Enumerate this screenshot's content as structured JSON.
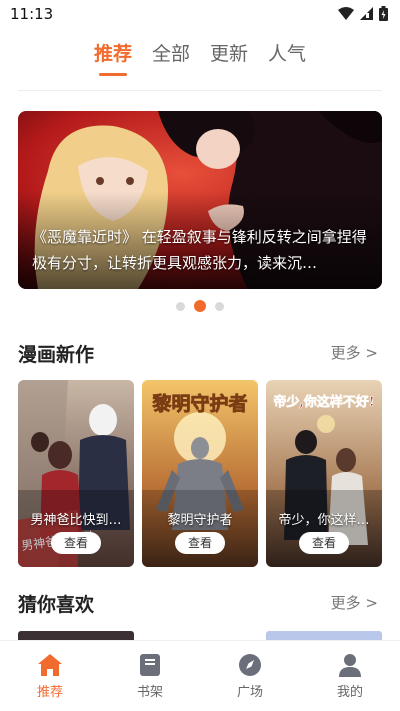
{
  "status_bar": {
    "time": "11:13"
  },
  "top_tabs": [
    {
      "label": "推荐",
      "active": true
    },
    {
      "label": "全部",
      "active": false
    },
    {
      "label": "更新",
      "active": false
    },
    {
      "label": "人气",
      "active": false
    }
  ],
  "banner": {
    "caption": "《恶魔靠近时》 在轻盈叙事与锋利反转之间拿捏得极有分寸，让转折更具观感张力，读来沉…",
    "pages": 3,
    "active_page": 2
  },
  "section_new": {
    "title": "漫画新作",
    "more": "更多 >",
    "items": [
      {
        "title": "男神爸比快到…",
        "button": "查看",
        "cover_text": "男神爸比快到"
      },
      {
        "title": "黎明守护者",
        "button": "查看",
        "cover_text": "黎明守护者"
      },
      {
        "title": "帝少，你这样…",
        "button": "查看",
        "cover_text": "帝少,你这样不好!"
      }
    ]
  },
  "section_guess": {
    "title": "猜你喜欢",
    "more": "更多 >"
  },
  "bottom_nav": [
    {
      "label": "推荐",
      "icon": "home-icon",
      "active": true
    },
    {
      "label": "书架",
      "icon": "book-icon",
      "active": false
    },
    {
      "label": "广场",
      "icon": "compass-icon",
      "active": false
    },
    {
      "label": "我的",
      "icon": "user-icon",
      "active": false
    }
  ],
  "colors": {
    "accent": "#f26b2e",
    "muted": "#666666"
  }
}
